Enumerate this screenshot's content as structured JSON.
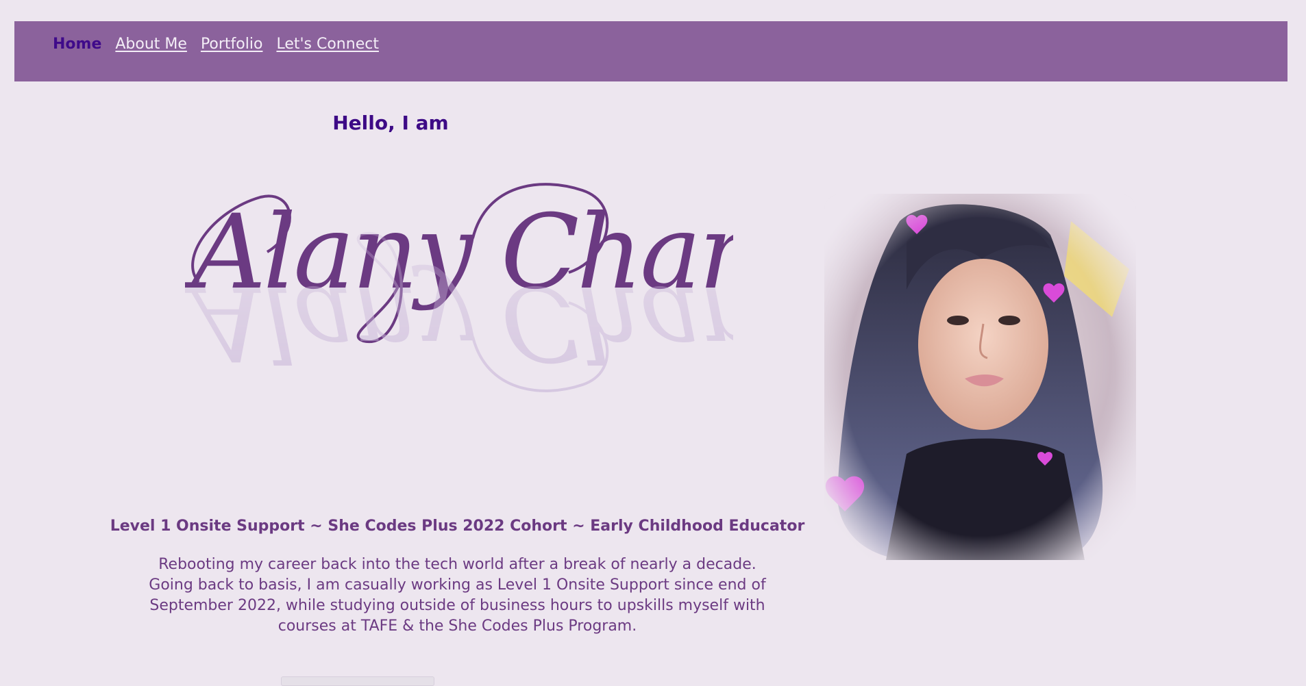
{
  "nav": {
    "items": [
      {
        "label": "Home",
        "active": true
      },
      {
        "label": "About Me",
        "active": false
      },
      {
        "label": "Portfolio",
        "active": false
      },
      {
        "label": "Let's Connect",
        "active": false
      }
    ]
  },
  "hero": {
    "greeting": "Hello, I am",
    "name": "Alany Chan",
    "headline": "Level 1 Onsite Support ~ She Codes Plus 2022 Cohort ~ Early Childhood Educator",
    "description": "Rebooting my career back into the tech world after a break of nearly a decade. Going back to basis, I am casually working as Level 1 Onsite Support since end of September 2022, while studying outside of business hours to upskills myself with courses at TAFE & the She Codes Plus Program."
  },
  "colors": {
    "page_background": "#ede6ef",
    "navbar": "#8b629c",
    "nav_active": "#3f0a8a",
    "nav_link": "#f4eef7",
    "accent_text": "#6b3a82",
    "greeting": "#3d0a86"
  },
  "icons": {
    "portrait": "profile-photo",
    "decorations": "heart-icons"
  }
}
